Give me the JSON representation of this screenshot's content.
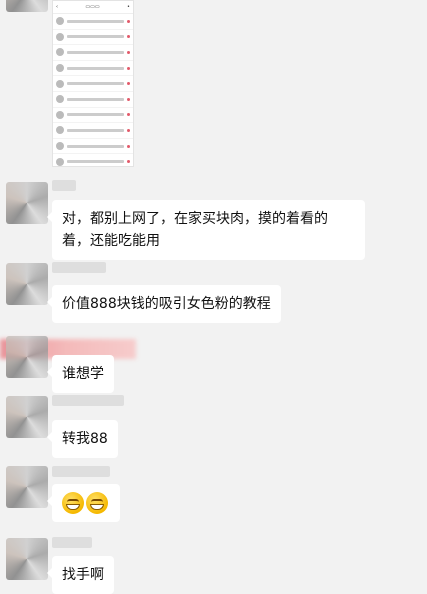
{
  "screenshot": {
    "status": "",
    "rows": 10
  },
  "messages": [
    {
      "text": "对，都别上网了，在家买块肉，摸的着看的着，还能吃能用"
    },
    {
      "text": "价值888块钱的吸引女色粉的教程"
    },
    {
      "text": "谁想学"
    },
    {
      "text": "转我88"
    },
    {
      "text": "😁😁"
    },
    {
      "text": "找手啊"
    }
  ],
  "colors": {
    "background": "#f2f2f2",
    "bubble": "#ffffff",
    "accent_pink": "#e25a6a"
  }
}
